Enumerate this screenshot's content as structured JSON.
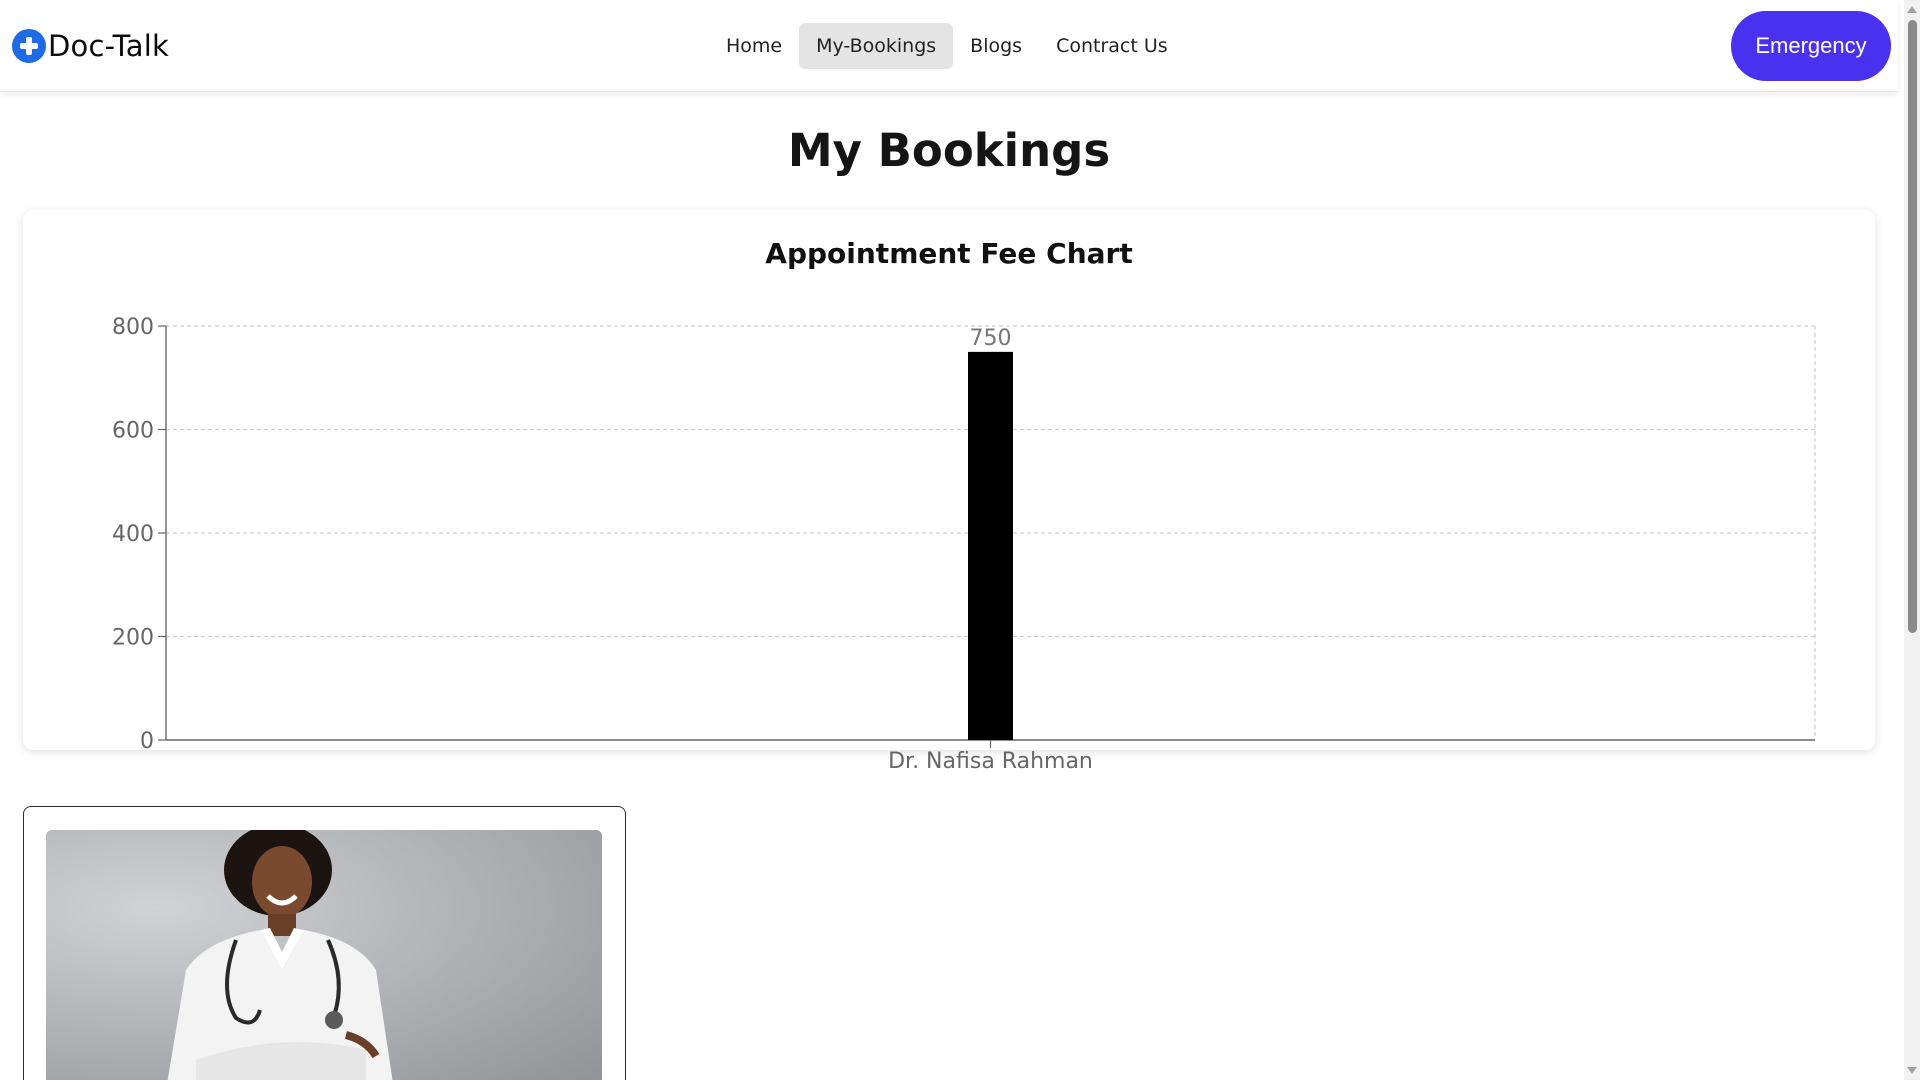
{
  "navbar": {
    "brand": "Doc-Talk",
    "links": [
      {
        "label": "Home",
        "active": false
      },
      {
        "label": "My-Bookings",
        "active": true
      },
      {
        "label": "Blogs",
        "active": false
      },
      {
        "label": "Contract Us",
        "active": false
      }
    ],
    "emergency_label": "Emergency"
  },
  "page": {
    "title": "My Bookings"
  },
  "colors": {
    "accent": "#4a31ef",
    "brand_icon": "#1f6ae6",
    "bar": "#000000"
  },
  "icons": {
    "brand": "medical-cross-icon"
  },
  "chart_data": {
    "type": "bar",
    "title": "Appointment Fee Chart",
    "categories": [
      "Dr. Nafisa Rahman"
    ],
    "values": [
      750
    ],
    "data_labels": [
      "750"
    ],
    "ylim": [
      0,
      800
    ],
    "yticks": [
      0,
      200,
      400,
      600,
      800
    ],
    "xlabel": "",
    "ylabel": "",
    "grid": true
  }
}
